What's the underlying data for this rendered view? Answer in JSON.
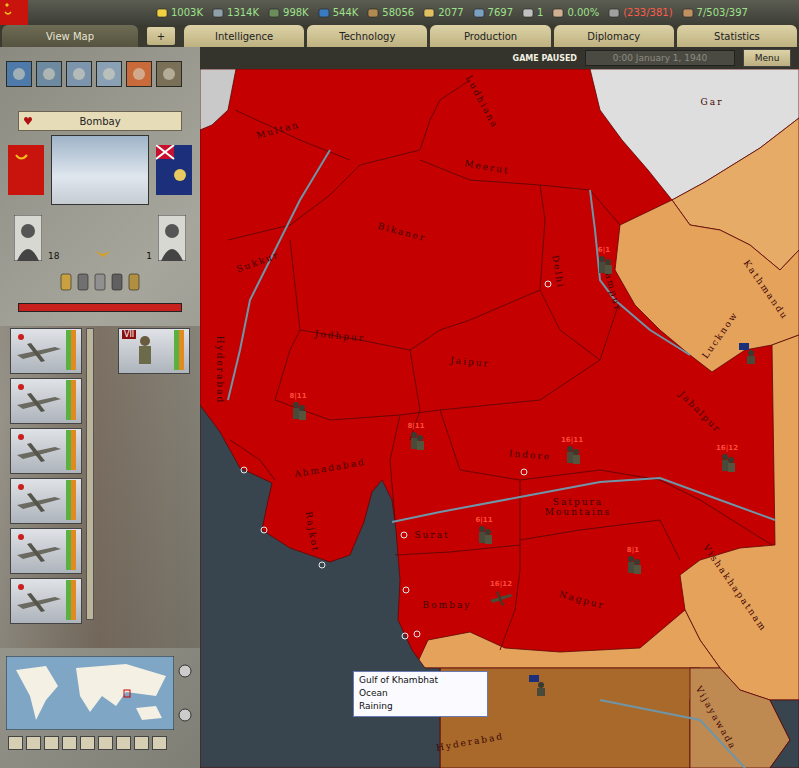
{
  "topbar": {
    "resources": [
      {
        "value": "1003K",
        "color": "#9fe28c"
      },
      {
        "value": "1314K",
        "color": "#9fe28c"
      },
      {
        "value": "998K",
        "color": "#9fe28c"
      },
      {
        "value": "544K",
        "color": "#9fe28c"
      },
      {
        "value": "58056",
        "color": "#9fe28c"
      },
      {
        "value": "2077",
        "color": "#9fe28c"
      },
      {
        "value": "7697",
        "color": "#9fe28c"
      },
      {
        "value": "1",
        "color": "#9fe28c"
      },
      {
        "value": "0.00%",
        "color": "#9fe28c"
      },
      {
        "value": "(233/381)",
        "color": "#ff5a4a"
      },
      {
        "value": "7/503/397",
        "color": "#9fe28c"
      }
    ]
  },
  "tabs": [
    {
      "label": "View Map",
      "selected": true
    },
    {
      "label": "+",
      "selected": false
    },
    {
      "label": "Intelligence",
      "selected": false
    },
    {
      "label": "Technology",
      "selected": false
    },
    {
      "label": "Production",
      "selected": false
    },
    {
      "label": "Diplomacy",
      "selected": false
    },
    {
      "label": "Statistics",
      "selected": false
    }
  ],
  "status": {
    "paused": "GAME PAUSED",
    "date": "0:00 January 1, 1940",
    "menu": "Menu"
  },
  "panel": {
    "province": "Bombay",
    "attacker_rank": "18",
    "defender_rank": "1",
    "strength_level": 1,
    "units": [
      {
        "kind": "bomber",
        "level": 1
      },
      {
        "kind": "bomber",
        "level": 1
      },
      {
        "kind": "bomber",
        "level": 1
      },
      {
        "kind": "bomber",
        "level": 1
      },
      {
        "kind": "bomber",
        "level": 1
      },
      {
        "kind": "bomber",
        "level": 1
      }
    ],
    "selected_unit": {
      "label": "VII",
      "kind": "infantry",
      "level": 1
    }
  },
  "map": {
    "territories": [
      {
        "color": "#c40000"
      },
      {
        "color": "#c9c9c9"
      },
      {
        "color": "#dedede"
      },
      {
        "color": "#e6ab66"
      },
      {
        "color": "#e5a25a"
      },
      {
        "color": "#a8692a"
      },
      {
        "color": "#bf8a52"
      },
      {
        "color": "#38454f"
      }
    ],
    "labels": [
      "Multan",
      "Ludhiana",
      "Meerut",
      "Sukkur",
      "Bikaner",
      "Delhi",
      "Rampur",
      "Lucknow",
      "Kathmandu",
      "Jodhpur",
      "Jaipur",
      "Hyderabad",
      "Ahmadabad",
      "Indore",
      "Jabalpur",
      "Rajkot",
      "Surat",
      "Satpura Mountains",
      "Bombay",
      "Nagpur",
      "Vishakhapatnam",
      "Vijayawada",
      "Hyderabad",
      "Gar"
    ],
    "counters": [
      {
        "label": "6|1",
        "kind": "infantry"
      },
      {
        "label": "8|11",
        "kind": "infantry"
      },
      {
        "label": "8|11",
        "kind": "infantry"
      },
      {
        "label": "16|11",
        "kind": "infantry"
      },
      {
        "label": "16|12",
        "kind": "infantry"
      },
      {
        "label": "6|11",
        "kind": "infantry"
      },
      {
        "label": "8|1",
        "kind": "infantry"
      },
      {
        "label": "16|12",
        "kind": "air"
      },
      {
        "kind": "foreign"
      },
      {
        "kind": "foreign"
      }
    ],
    "tooltip": {
      "lines": [
        "Gulf of Khambhat",
        "Ocean",
        "Raining"
      ]
    }
  }
}
